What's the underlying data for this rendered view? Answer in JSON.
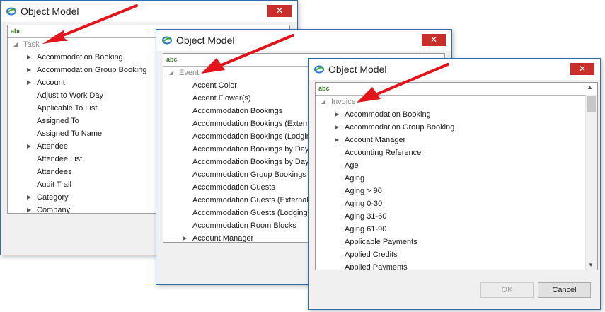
{
  "windows": [
    {
      "title": "Object Model",
      "close_glyph": "✕",
      "search_text": "abc",
      "root_label": "Task",
      "items": [
        {
          "label": "Accommodation Booking",
          "expandable": true
        },
        {
          "label": "Accommodation Group Booking",
          "expandable": true
        },
        {
          "label": "Account",
          "expandable": true
        },
        {
          "label": "Adjust to Work Day",
          "expandable": false
        },
        {
          "label": "Applicable To List",
          "expandable": false
        },
        {
          "label": "Assigned To",
          "expandable": false
        },
        {
          "label": "Assigned To Name",
          "expandable": false
        },
        {
          "label": "Attendee",
          "expandable": true
        },
        {
          "label": "Attendee List",
          "expandable": false
        },
        {
          "label": "Attendees",
          "expandable": false
        },
        {
          "label": "Audit Trail",
          "expandable": false
        },
        {
          "label": "Category",
          "expandable": true
        },
        {
          "label": "Company",
          "expandable": true
        }
      ]
    },
    {
      "title": "Object Model",
      "close_glyph": "✕",
      "search_text": "abc",
      "root_label": "Event",
      "items": [
        {
          "label": "Accent Color",
          "expandable": false
        },
        {
          "label": "Accent Flower(s)",
          "expandable": false
        },
        {
          "label": "Accommodation Bookings",
          "expandable": false
        },
        {
          "label": "Accommodation Bookings (External)",
          "expandable": false
        },
        {
          "label": "Accommodation Bookings (Lodging)",
          "expandable": false
        },
        {
          "label": "Accommodation Bookings by Day (External)",
          "expandable": false
        },
        {
          "label": "Accommodation Bookings by Day (Lodging)",
          "expandable": false
        },
        {
          "label": "Accommodation Group Bookings",
          "expandable": false
        },
        {
          "label": "Accommodation Guests",
          "expandable": false
        },
        {
          "label": "Accommodation Guests (External)",
          "expandable": false
        },
        {
          "label": "Accommodation Guests (Lodging)",
          "expandable": false
        },
        {
          "label": "Accommodation Room Blocks",
          "expandable": false
        },
        {
          "label": "Account Manager",
          "expandable": true
        }
      ]
    },
    {
      "title": "Object Model",
      "close_glyph": "✕",
      "search_text": "abc",
      "root_label": "Invoice",
      "items": [
        {
          "label": "Accommodation Booking",
          "expandable": true
        },
        {
          "label": "Accommodation Group Booking",
          "expandable": true
        },
        {
          "label": "Account Manager",
          "expandable": true
        },
        {
          "label": "Accounting Reference",
          "expandable": false
        },
        {
          "label": "Age",
          "expandable": false
        },
        {
          "label": "Aging",
          "expandable": false
        },
        {
          "label": "Aging > 90",
          "expandable": false
        },
        {
          "label": "Aging 0-30",
          "expandable": false
        },
        {
          "label": "Aging 31-60",
          "expandable": false
        },
        {
          "label": "Aging 61-90",
          "expandable": false
        },
        {
          "label": "Applicable Payments",
          "expandable": false
        },
        {
          "label": "Applied Credits",
          "expandable": false
        },
        {
          "label": "Applied Payments",
          "expandable": false
        }
      ],
      "ok_label": "OK",
      "cancel_label": "Cancel"
    }
  ],
  "colors": {
    "window_border": "#2f6fb0",
    "close_button": "#c9302c",
    "arrow": "#e3141b",
    "root_text": "#8a8a8a"
  },
  "icons": {
    "app": "object-model-icon",
    "close": "close-icon",
    "expand": "expand-triangle-icon",
    "collapse": "collapse-triangle-icon"
  }
}
